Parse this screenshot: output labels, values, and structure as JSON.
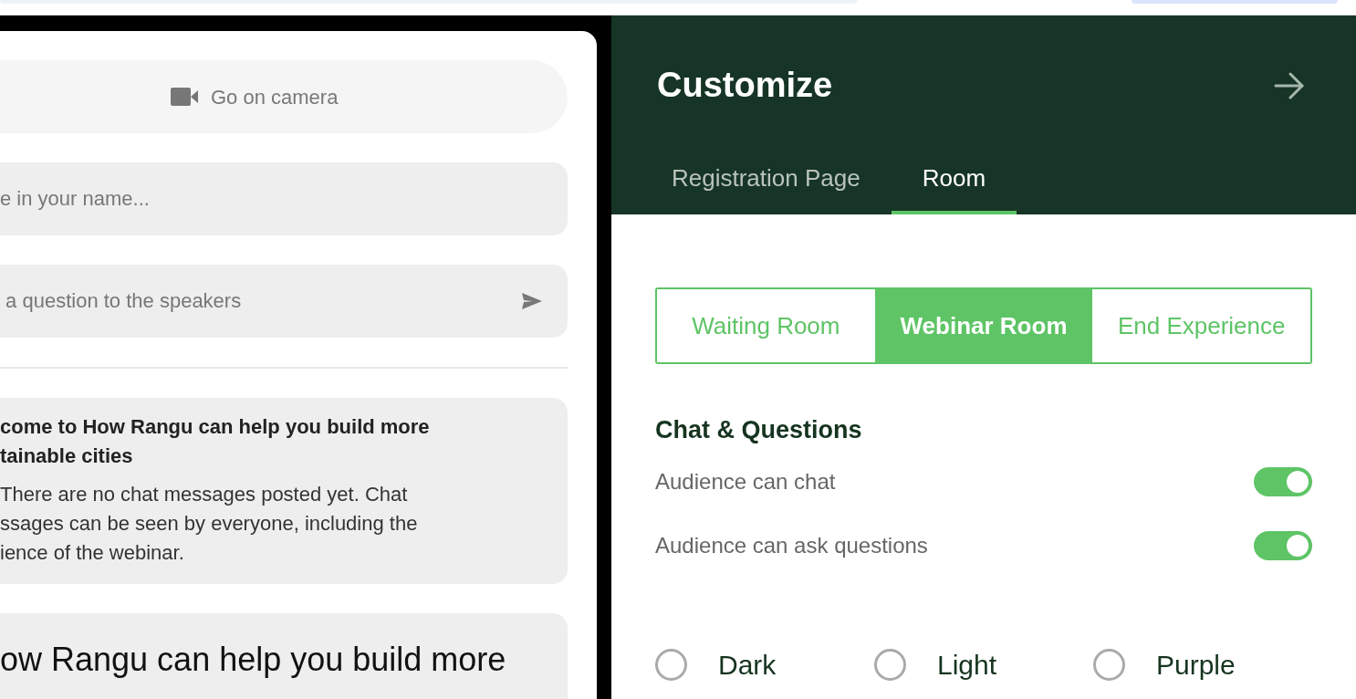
{
  "left_panel": {
    "camera_button": "Go on camera",
    "name_field": {
      "placeholder": "e in your name..."
    },
    "question_field": {
      "placeholder": " a question to the speakers"
    },
    "welcome_message": {
      "title_lines": [
        "come to How Rangu can help you build more",
        "tainable cities"
      ],
      "body_lines": [
        "There are no chat messages posted yet. Chat",
        "ssages can be seen by everyone, including the",
        "ience of the webinar."
      ]
    },
    "event_title_lines": [
      "ow Rangu can help you build more"
    ]
  },
  "customize": {
    "title": "Customize",
    "tabs": [
      {
        "label": "Registration Page",
        "selected": false
      },
      {
        "label": "Room",
        "selected": true
      }
    ],
    "room_tabs": [
      {
        "label": "Waiting Room",
        "selected": false
      },
      {
        "label": "Webinar Room",
        "selected": true
      },
      {
        "label": "End Experience",
        "selected": false
      }
    ],
    "section_title": "Chat & Questions",
    "toggles": [
      {
        "label": "Audience can chat",
        "on": true
      },
      {
        "label": "Audience can ask questions",
        "on": true
      }
    ],
    "themes": [
      {
        "label": "Dark",
        "selected": false
      },
      {
        "label": "Light",
        "selected": false
      },
      {
        "label": "Purple",
        "selected": false
      }
    ]
  }
}
